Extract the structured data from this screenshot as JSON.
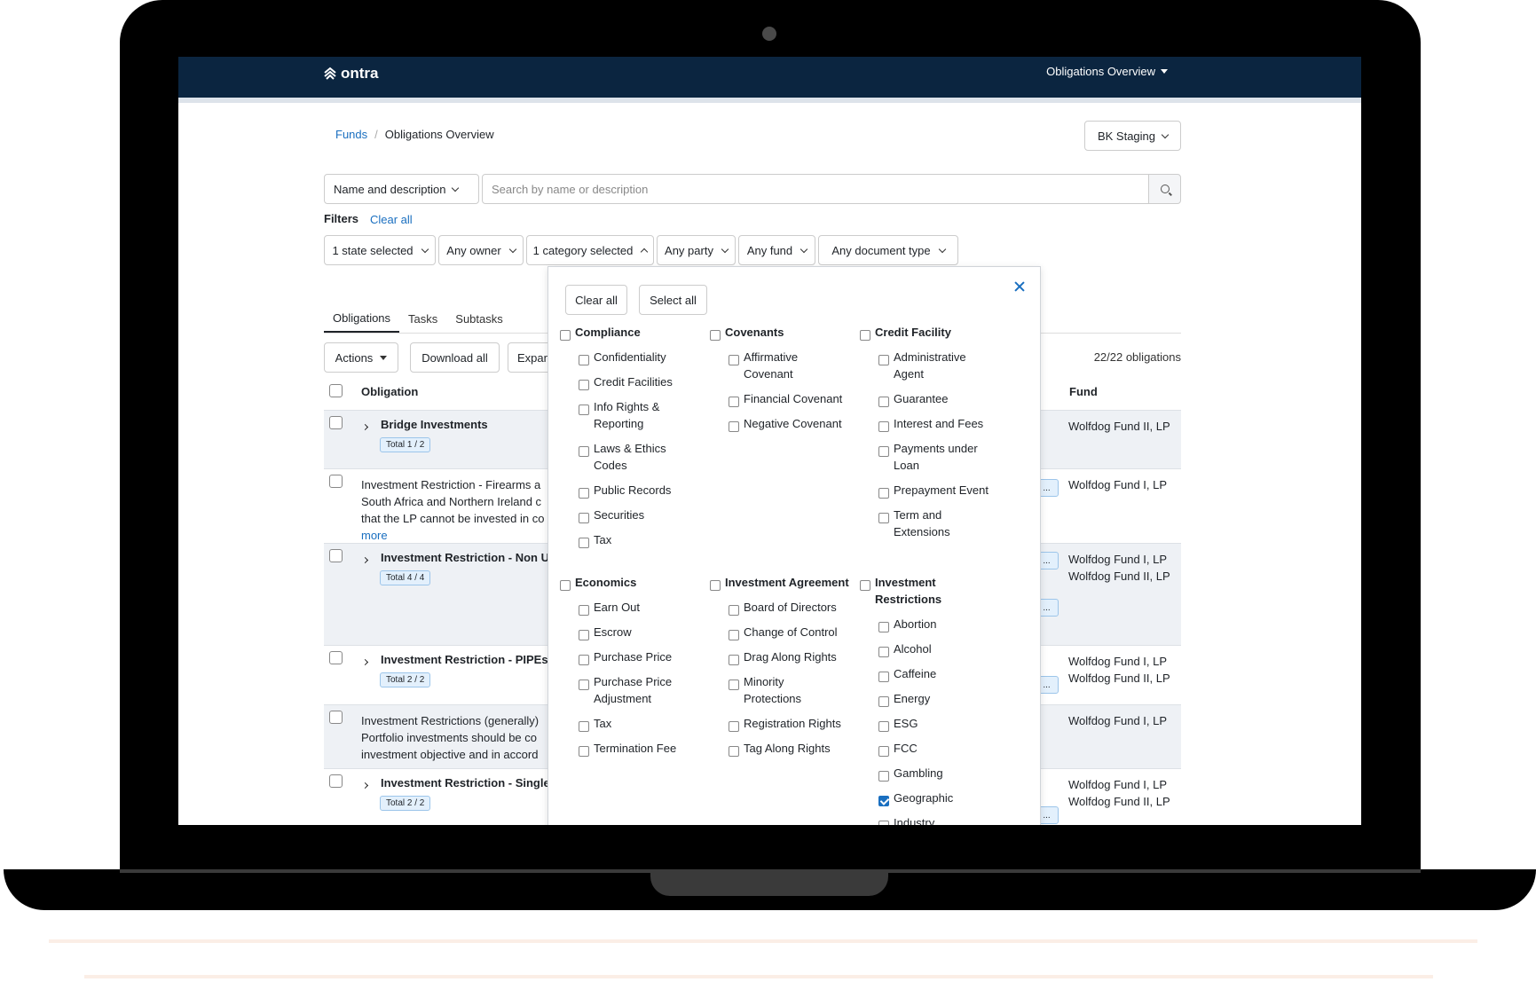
{
  "nav": {
    "logo": "ontra",
    "menu": "Obligations Overview"
  },
  "breadcrumb": {
    "root": "Funds",
    "sep": "/",
    "current": "Obligations Overview"
  },
  "env": "BK Staging",
  "search": {
    "type": "Name and description",
    "placeholder": "Search by name or description"
  },
  "filters": {
    "label": "Filters",
    "clear": "Clear all",
    "state": "1 state selected",
    "owner": "Any owner",
    "category": "1 category selected",
    "party": "Any party",
    "fund": "Any fund",
    "doctype": "Any document type"
  },
  "tabs": [
    "Obligations",
    "Tasks",
    "Subtasks"
  ],
  "toolbar": {
    "actions": "Actions",
    "download": "Download all",
    "expand": "Expan",
    "count": "22/22 obligations"
  },
  "table": {
    "col_obligation": "Obligation",
    "col_fund": "Fund"
  },
  "rows": [
    {
      "title": "Bridge Investments",
      "badge": "Total 1 / 2",
      "funds": [
        "Wolfdog Fund II, LP"
      ]
    },
    {
      "lines": [
        "Investment Restriction - Firearms a",
        "South Africa and Northern Ireland c",
        "that the LP cannot be invested in co"
      ],
      "more": "more",
      "funds": [
        "Wolfdog Fund I, LP"
      ]
    },
    {
      "title": "Investment Restriction - Non U",
      "badge": "Total 4 / 4",
      "funds": [
        "Wolfdog Fund I, LP",
        "Wolfdog Fund II, LP"
      ]
    },
    {
      "title": "Investment Restriction - PIPEs",
      "badge": "Total 2 / 2",
      "funds": [
        "Wolfdog Fund I, LP",
        "Wolfdog Fund II, LP"
      ]
    },
    {
      "lines": [
        "Investment Restrictions (generally)",
        "Portfolio investments should be co",
        "investment objective and in accord"
      ],
      "funds": [
        "Wolfdog Fund I, LP"
      ]
    },
    {
      "title": "Investment Restriction - Single",
      "badge": "Total 2 / 2",
      "funds": [
        "Wolfdog Fund I, LP",
        "Wolfdog Fund II, LP"
      ]
    }
  ],
  "trunc": "...",
  "panel": {
    "clear": "Clear all",
    "select": "Select all",
    "compliance": {
      "head": "Compliance",
      "items": [
        "Confidentiality",
        "Credit Facilities",
        "Info Rights &",
        "Reporting",
        "Laws & Ethics",
        "Codes",
        "Public Records",
        "Securities",
        "Tax"
      ]
    },
    "covenants": {
      "head": "Covenants",
      "items": [
        "Affirmative",
        "Covenant",
        "Financial Covenant",
        "Negative Covenant"
      ]
    },
    "credit": {
      "head": "Credit Facility",
      "items": [
        "Administrative",
        "Agent",
        "Guarantee",
        "Interest and Fees",
        "Payments under",
        "Loan",
        "Prepayment Event",
        "Term and",
        "Extensions"
      ]
    },
    "economics": {
      "head": "Economics",
      "items": [
        "Earn Out",
        "Escrow",
        "Purchase Price",
        "Purchase Price",
        "Adjustment",
        "Tax",
        "Termination Fee"
      ]
    },
    "agreement": {
      "head": "Investment Agreement",
      "items": [
        "Board of Directors",
        "Change of Control",
        "Drag Along Rights",
        "Minority",
        "Protections",
        "Registration Rights",
        "Tag Along Rights"
      ]
    },
    "restrictions": {
      "head1": "Investment",
      "head2": "Restrictions",
      "items": [
        "Abortion",
        "Alcohol",
        "Caffeine",
        "Energy",
        "ESG",
        "FCC",
        "Gambling",
        "Geographic",
        "Industry"
      ]
    }
  }
}
